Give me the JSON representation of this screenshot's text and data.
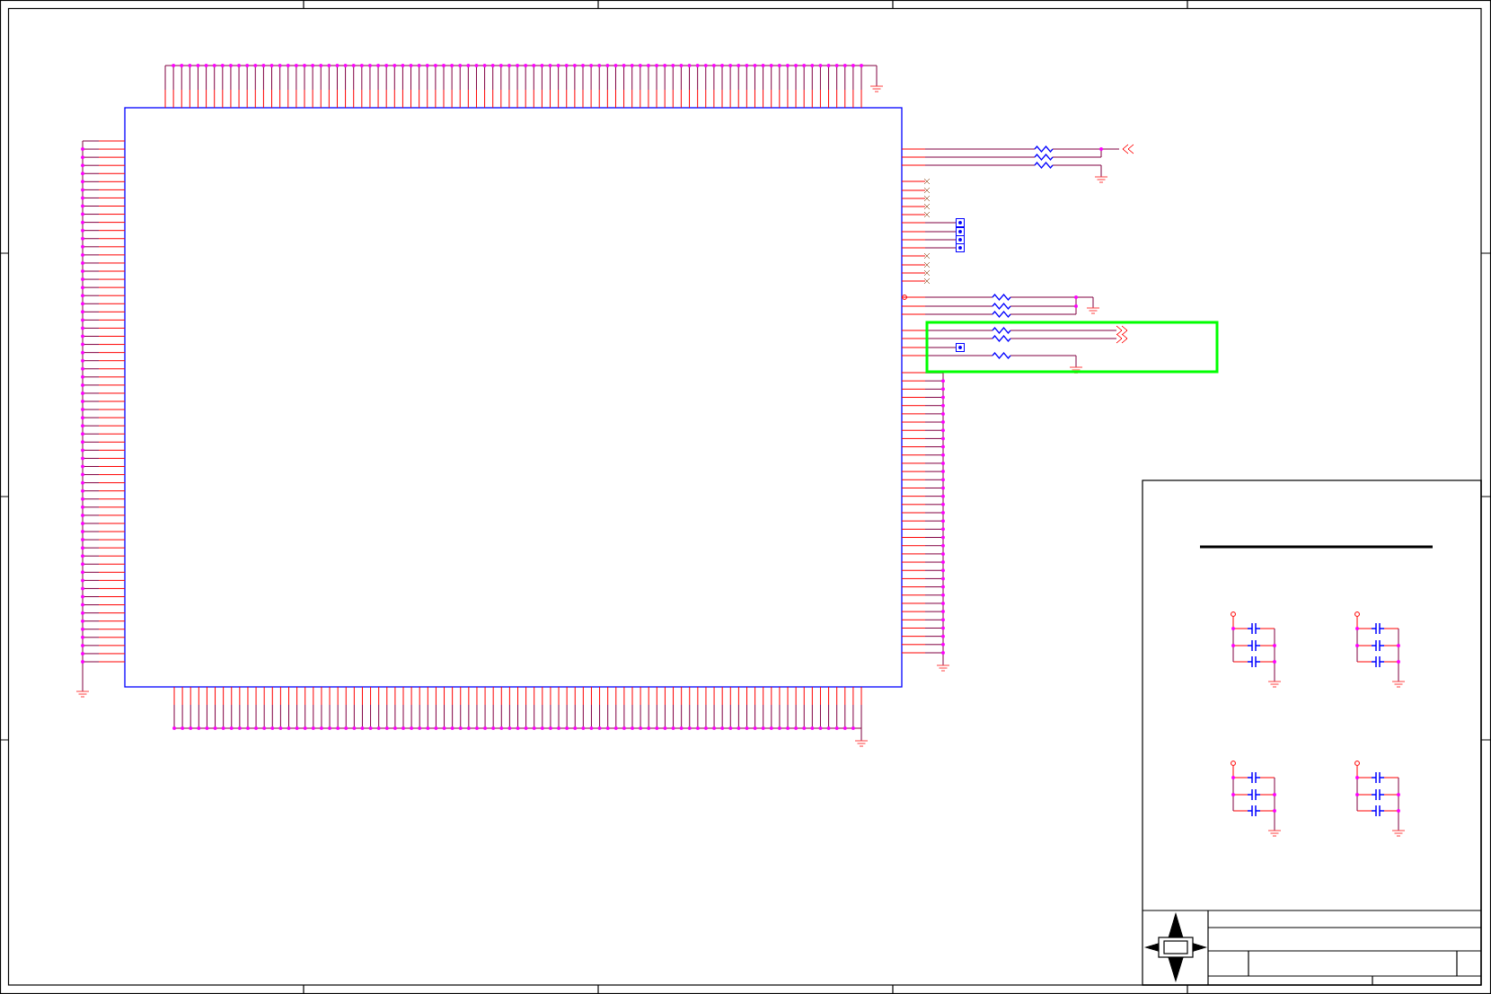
{
  "selection_highlight": {
    "selected": true
  }
}
